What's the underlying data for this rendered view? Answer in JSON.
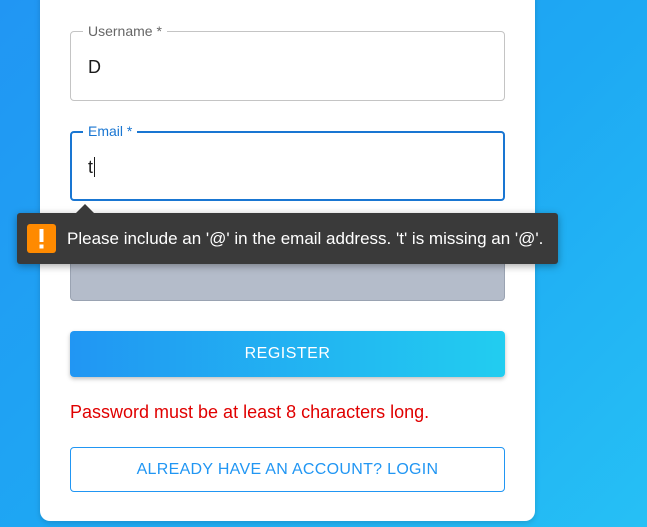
{
  "form": {
    "username": {
      "label": "Username *",
      "value": "D"
    },
    "email": {
      "label": "Email *",
      "value": "t"
    },
    "password": {
      "masked_value": "••••••"
    },
    "register_label": "REGISTER",
    "error_message": "Password must be at least 8 characters long.",
    "login_label": "ALREADY HAVE AN ACCOUNT? LOGIN"
  },
  "validation_tooltip": {
    "icon": "warning-icon",
    "message": "Please include an '@' in the email address. 't' is missing an '@'."
  },
  "colors": {
    "accent": "#1976d2",
    "error": "#e00000",
    "tooltip_bg": "#3a3a3a",
    "warning": "#ff8a00"
  }
}
